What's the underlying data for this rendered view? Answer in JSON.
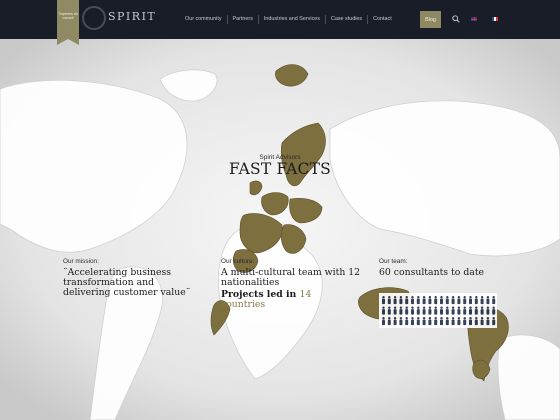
{
  "award": {
    "text": "Trophées du conseil"
  },
  "logo": {
    "text": "SPIRIT"
  },
  "nav": {
    "items": [
      "Our community",
      "Partners",
      "Industries and Services",
      "Case studies",
      "Contact"
    ],
    "blog": "Blog"
  },
  "hero": {
    "eyebrow": "Spirit Advisors",
    "title": "FAST FACTS"
  },
  "mission": {
    "label": "Our mission:",
    "text": "¨Accelerating business transformation and delivering customer value¨"
  },
  "culture": {
    "label": "Our culture:",
    "text": "A multi-cultural team with 12 nationalities",
    "projects_prefix": "Projects led in ",
    "projects_count": "14",
    "projects_suffix": "countries"
  },
  "team": {
    "label": "Our team:",
    "text": "60 consultants to date"
  },
  "icons": [
    "search-icon",
    "uk-flag-icon",
    "fr-flag-icon",
    "people-icon"
  ],
  "colors": {
    "header": "#191d28",
    "accent": "#8e8962",
    "map_land": "#7e6f3f",
    "map_bg": "#e9e9e9"
  }
}
